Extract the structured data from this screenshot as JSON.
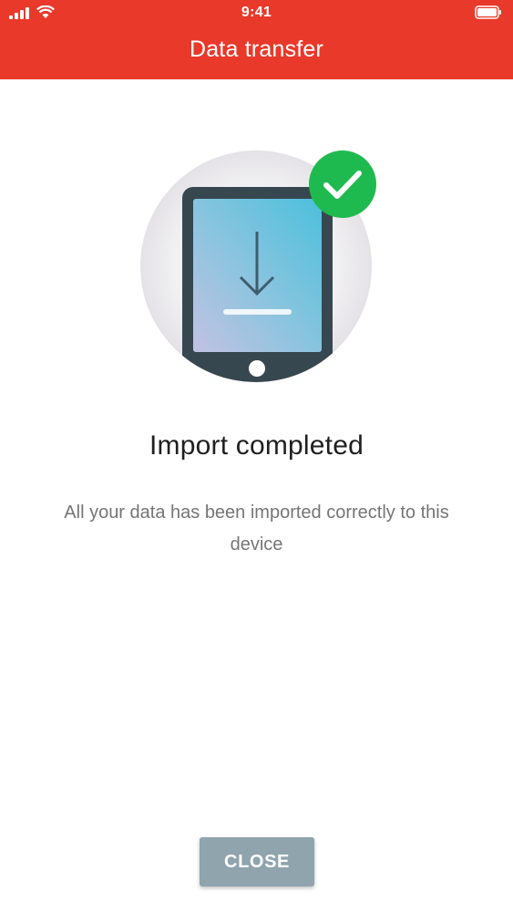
{
  "status_bar": {
    "time": "9:41"
  },
  "header": {
    "title": "Data transfer",
    "background_color": "#e8392a"
  },
  "illustration": {
    "device_icon": "tablet-download-icon",
    "badge_icon": "checkmark-icon",
    "badge_color": "#1fba4f"
  },
  "content": {
    "heading": "Import completed",
    "message": "All your data has been imported correctly to this device"
  },
  "actions": {
    "close_label": "CLOSE",
    "close_color": "#8fa4ad"
  }
}
